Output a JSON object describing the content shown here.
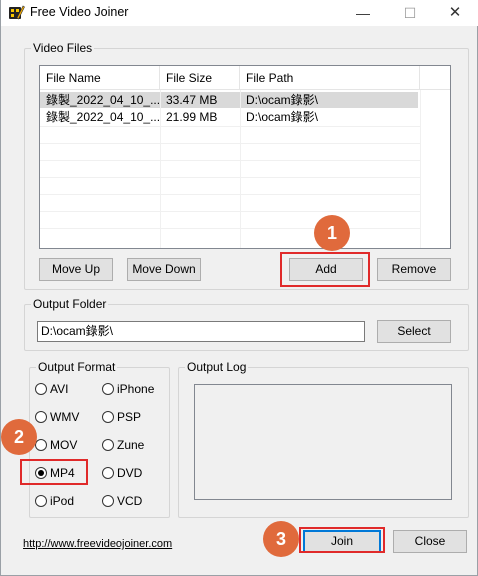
{
  "window": {
    "title": "Free Video Joiner",
    "app_icon": "film-pencil-icon"
  },
  "titlebar": {
    "minimize": "—",
    "maximize": "☐",
    "close": "✕"
  },
  "video_files": {
    "group_label": "Video Files",
    "columns": [
      "File Name",
      "File Size",
      "File Path"
    ],
    "rows": [
      {
        "name": "錄製_2022_04_10_...",
        "size": "33.47 MB",
        "path": "D:\\ocam錄影\\",
        "selected": true
      },
      {
        "name": "錄製_2022_04_10_...",
        "size": "21.99 MB",
        "path": "D:\\ocam錄影\\",
        "selected": false
      }
    ],
    "buttons": {
      "move_up": "Move Up",
      "move_down": "Move Down",
      "add": "Add",
      "remove": "Remove"
    }
  },
  "output_folder": {
    "group_label": "Output Folder",
    "value": "D:\\ocam錄影\\",
    "select_label": "Select"
  },
  "output_format": {
    "group_label": "Output Format",
    "left": [
      {
        "label": "AVI",
        "checked": false
      },
      {
        "label": "WMV",
        "checked": false
      },
      {
        "label": "MOV",
        "checked": false
      },
      {
        "label": "MP4",
        "checked": true
      },
      {
        "label": "iPod",
        "checked": false
      }
    ],
    "right": [
      {
        "label": "iPhone",
        "checked": false
      },
      {
        "label": "PSP",
        "checked": false
      },
      {
        "label": "Zune",
        "checked": false
      },
      {
        "label": "DVD",
        "checked": false
      },
      {
        "label": "VCD",
        "checked": false
      }
    ]
  },
  "output_log": {
    "group_label": "Output Log"
  },
  "footer": {
    "link": "http://www.freevideojoiner.com",
    "join": "Join",
    "close": "Close"
  },
  "annotations": {
    "marker_1": "1",
    "marker_2": "2",
    "marker_3": "3",
    "highlight_color": "#e02a2a",
    "marker_color": "#e06a3c"
  }
}
